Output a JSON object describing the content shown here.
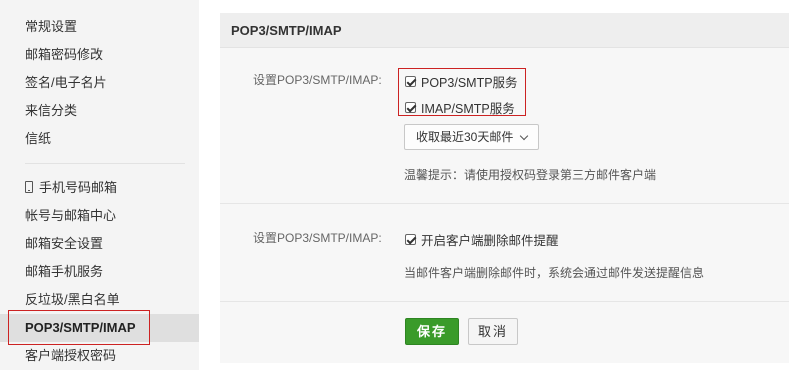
{
  "sidebar": {
    "group1": [
      {
        "label": "常规设置"
      },
      {
        "label": "邮箱密码修改"
      },
      {
        "label": "签名/电子名片"
      },
      {
        "label": "来信分类"
      },
      {
        "label": "信纸"
      }
    ],
    "group2": [
      {
        "label": "手机号码邮箱"
      },
      {
        "label": "帐号与邮箱中心"
      },
      {
        "label": "邮箱安全设置"
      },
      {
        "label": "邮箱手机服务"
      },
      {
        "label": "反垃圾/黑白名单"
      },
      {
        "label": "POP3/SMTP/IMAP"
      },
      {
        "label": "客户端授权密码"
      }
    ]
  },
  "panel": {
    "title": "POP3/SMTP/IMAP",
    "section1": {
      "label": "设置POP3/SMTP/IMAP:",
      "pop3_option": "POP3/SMTP服务",
      "imap_option": "IMAP/SMTP服务",
      "dropdown_value": "收取最近30天邮件",
      "hint": "温馨提示：请使用授权码登录第三方邮件客户端"
    },
    "section2": {
      "label": "设置POP3/SMTP/IMAP:",
      "delete_notify_option": "开启客户端删除邮件提醒",
      "hint": "当邮件客户端删除邮件时，系统会通过邮件发送提醒信息"
    },
    "buttons": {
      "save": "保存",
      "cancel": "取消"
    }
  }
}
